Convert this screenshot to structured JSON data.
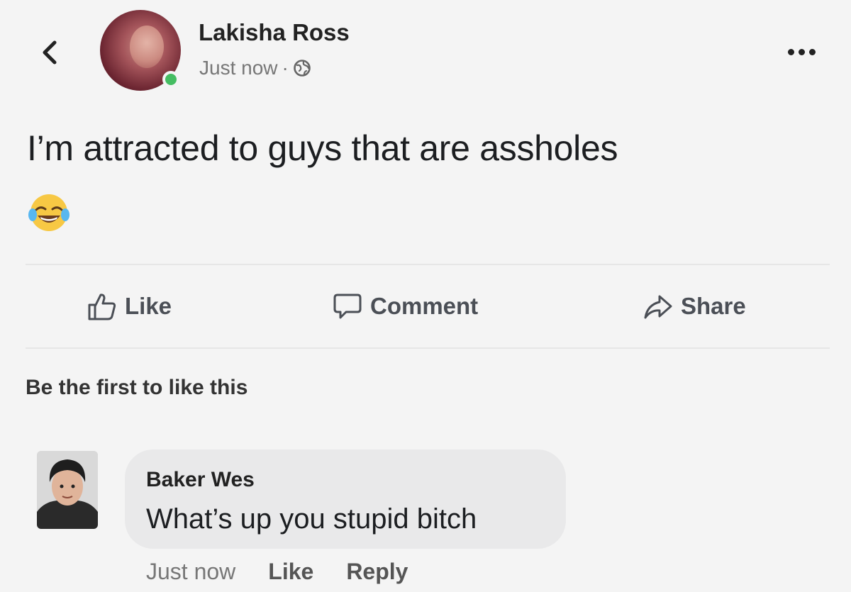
{
  "header": {
    "author_name": "Lakisha Ross",
    "timestamp": "Just now",
    "separator": "·",
    "back_icon": "chevron-left-icon",
    "privacy_icon": "globe-icon",
    "more_icon": "more-horizontal-icon",
    "online_status_color": "#45bd62"
  },
  "post": {
    "text": "I’m attracted to guys that are assholes",
    "emoji": "face-with-tears-of-joy"
  },
  "actions": {
    "like_label": "Like",
    "comment_label": "Comment",
    "share_label": "Share"
  },
  "reactions": {
    "summary": "Be the first to like this"
  },
  "comment": {
    "author": "Baker Wes",
    "text": "What’s up you stupid bitch",
    "timestamp": "Just now",
    "like_label": "Like",
    "reply_label": "Reply"
  }
}
